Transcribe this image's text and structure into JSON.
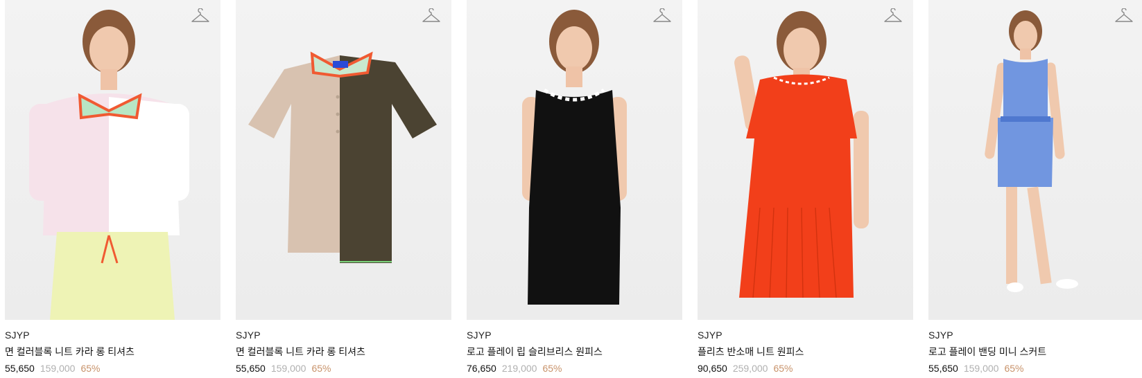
{
  "products": [
    {
      "brand": "SJYP",
      "name": "면 컬러블록 니트 카라 롱 티셔츠",
      "sale_price": "55,650",
      "original_price": "159,000",
      "discount": "65%",
      "image_alt": "model-wearing-pink-collar-tshirt"
    },
    {
      "brand": "SJYP",
      "name": "면 컬러블록 니트 카라 롱 티셔츠",
      "sale_price": "55,650",
      "original_price": "159,000",
      "discount": "65%",
      "image_alt": "flat-colorblock-collar-tshirt"
    },
    {
      "brand": "SJYP",
      "name": "로고 플레이 립 슬리브리스 원피스",
      "sale_price": "76,650",
      "original_price": "219,000",
      "discount": "65%",
      "image_alt": "model-wearing-black-sleeveless-dress"
    },
    {
      "brand": "SJYP",
      "name": "플리츠 반소매 니트 원피스",
      "sale_price": "90,650",
      "original_price": "259,000",
      "discount": "65%",
      "image_alt": "model-wearing-orange-pleated-dress"
    },
    {
      "brand": "SJYP",
      "name": "로고 플레이 밴딩 미니 스커트",
      "sale_price": "55,650",
      "original_price": "159,000",
      "discount": "65%",
      "image_alt": "model-wearing-blue-knit-set"
    }
  ],
  "colors": {
    "sale": "#111111",
    "original": "#b0b0b0",
    "discount": "#c8926a",
    "thumb_bg": "#f1f1f1"
  },
  "icons": {
    "wishlist": "hanger-icon"
  }
}
